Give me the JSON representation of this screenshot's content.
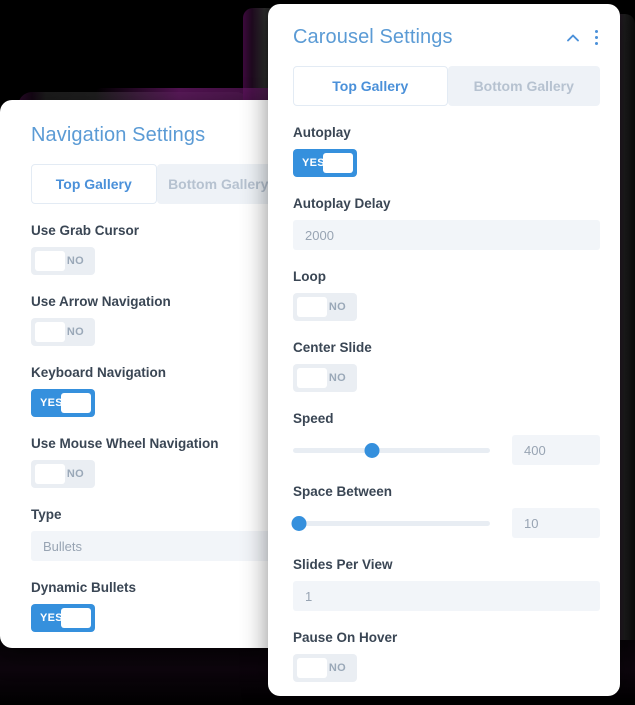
{
  "background": {
    "color": "#000000",
    "accent": "#6e196e"
  },
  "theme": {
    "title_color": "#5b9bd5",
    "toggle_on_color": "#3590dd",
    "toggle_off_color": "#eaeef3",
    "field_bg": "#f2f5f9",
    "tab_active_color": "#4a90d9",
    "tab_inactive_color": "#b6c2d0"
  },
  "navigation_panel": {
    "title": "Navigation Settings",
    "tabs": [
      {
        "label": "Top Gallery",
        "active": true
      },
      {
        "label": "Bottom Gallery",
        "active": false
      }
    ],
    "fields": [
      {
        "label": "Use Grab Cursor",
        "type": "toggle",
        "value": "NO",
        "on": false
      },
      {
        "label": "Use Arrow Navigation",
        "type": "toggle",
        "value": "NO",
        "on": false
      },
      {
        "label": "Keyboard Navigation",
        "type": "toggle",
        "value": "YES",
        "on": true
      },
      {
        "label": "Use Mouse Wheel Navigation",
        "type": "toggle",
        "value": "NO",
        "on": false
      },
      {
        "label": "Type",
        "type": "text",
        "value": "Bullets"
      },
      {
        "label": "Dynamic Bullets",
        "type": "toggle",
        "value": "YES",
        "on": true
      }
    ]
  },
  "carousel_panel": {
    "title": "Carousel Settings",
    "header_icons": [
      "chevron-up-icon",
      "kebab-menu-icon"
    ],
    "tabs": [
      {
        "label": "Top Gallery",
        "active": true
      },
      {
        "label": "Bottom Gallery",
        "active": false
      }
    ],
    "fields": [
      {
        "label": "Autoplay",
        "type": "toggle",
        "value": "YES",
        "on": true
      },
      {
        "label": "Autoplay Delay",
        "type": "text",
        "value": "2000"
      },
      {
        "label": "Loop",
        "type": "toggle",
        "value": "NO",
        "on": false
      },
      {
        "label": "Center Slide",
        "type": "toggle",
        "value": "NO",
        "on": false
      },
      {
        "label": "Speed",
        "type": "slider",
        "value": "400",
        "percent": 40
      },
      {
        "label": "Space Between",
        "type": "slider",
        "value": "10",
        "percent": 3
      },
      {
        "label": "Slides Per View",
        "type": "text",
        "value": "1"
      },
      {
        "label": "Pause On Hover",
        "type": "toggle",
        "value": "NO",
        "on": false
      }
    ]
  }
}
